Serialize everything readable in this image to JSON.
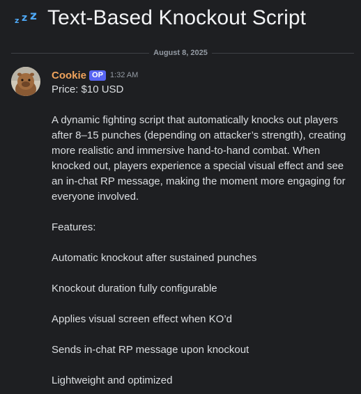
{
  "thread": {
    "title": "Text-Based Knockout Script",
    "icon": "zzz-icon"
  },
  "date_divider": "August 8, 2025",
  "message": {
    "author": "Cookie",
    "badge": "OP",
    "time": "1:32 AM",
    "lines": {
      "price": "Price: $10 USD",
      "description": "A dynamic fighting script that automatically knocks out players after 8–15 punches (depending on attacker’s strength), creating more realistic and immersive hand-to-hand combat. When knocked out, players experience a special visual effect and see an in-chat RP message, making the moment more engaging for everyone involved.",
      "features_heading": "Features:",
      "features": [
        "Automatic knockout after sustained punches",
        "Knockout duration fully configurable",
        "Applies visual screen effect when KO’d",
        "Sends in-chat RP message upon knockout",
        "Lightweight and optimized"
      ]
    }
  },
  "colors": {
    "background": "#1e1f22",
    "author": "#f0a35c",
    "op_badge": "#5865f2",
    "zzz_icon": "#4ea8f5"
  }
}
